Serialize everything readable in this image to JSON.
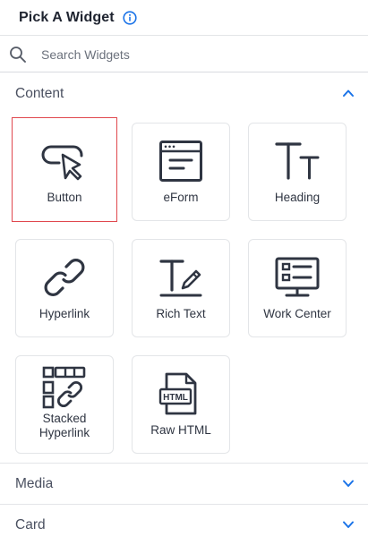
{
  "header": {
    "title": "Pick A Widget",
    "info_icon": "info-icon"
  },
  "search": {
    "placeholder": "Search Widgets",
    "value": "",
    "icon": "search-icon"
  },
  "sections": {
    "content": {
      "label": "Content",
      "expanded": true
    },
    "media": {
      "label": "Media",
      "expanded": false
    },
    "card": {
      "label": "Card",
      "expanded": false
    }
  },
  "widgets": [
    {
      "label": "Button",
      "icon": "button-cursor-icon",
      "selected": true
    },
    {
      "label": "eForm",
      "icon": "eform-icon",
      "selected": false
    },
    {
      "label": "Heading",
      "icon": "heading-icon",
      "selected": false
    },
    {
      "label": "Hyperlink",
      "icon": "hyperlink-icon",
      "selected": false
    },
    {
      "label": "Rich Text",
      "icon": "rich-text-icon",
      "selected": false
    },
    {
      "label": "Work Center",
      "icon": "work-center-icon",
      "selected": false
    },
    {
      "label": "Stacked Hyperlink",
      "icon": "stacked-hyperlink-icon",
      "selected": false
    },
    {
      "label": "Raw HTML",
      "icon": "raw-html-icon",
      "selected": false
    }
  ],
  "html_badge_text": "HTML",
  "colors": {
    "accent": "#1a73e8",
    "selected_border": "#e0484e",
    "icon_stroke": "#2f3542",
    "border": "#e3e5e8"
  }
}
